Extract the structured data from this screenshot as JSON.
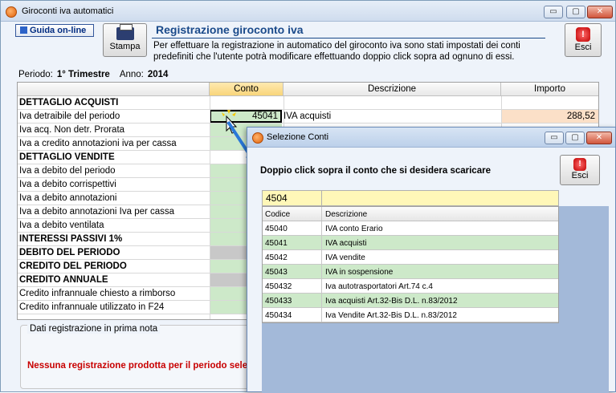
{
  "main_window": {
    "title": "Giroconti iva automatici",
    "controls": {
      "minimize": "▭",
      "maximize": "▢",
      "close": "✕"
    }
  },
  "toolbar": {
    "guida_label": "Guida on-line",
    "stampa_label": "Stampa",
    "esci_label": "Esci",
    "esci_icon": "!"
  },
  "header": {
    "title": "Registrazione giroconto iva",
    "description": "Per effettuare la registrazione in automatico del giroconto iva sono stati impostati dei conti predefiniti che l'utente potrà modificare effettuando doppio click sopra ad ognuno di essi."
  },
  "period": {
    "periodo_label": "Periodo:",
    "periodo_value": "1° Trimestre",
    "anno_label": "Anno:",
    "anno_value": "2014"
  },
  "grid": {
    "columns": {
      "conto": "Conto",
      "descrizione": "Descrizione",
      "importo": "Importo"
    },
    "rows": [
      {
        "label": "DETTAGLIO ACQUISTI",
        "bold": true,
        "conto_style": "none"
      },
      {
        "label": "Iva detraibile del periodo",
        "conto": "45041",
        "descrizione": "IVA acquisti",
        "importo": "288,52",
        "conto_style": "selected"
      },
      {
        "label": "Iva acq. Non detr. Prorata",
        "conto_style": "green"
      },
      {
        "label": "Iva a credito annotazioni iva per cassa",
        "conto_style": "green"
      },
      {
        "label": "DETTAGLIO VENDITE",
        "bold": true,
        "conto_style": "none"
      },
      {
        "label": "Iva a debito del periodo",
        "conto_style": "green"
      },
      {
        "label": "Iva a debito corrispettivi",
        "conto_style": "green"
      },
      {
        "label": "Iva a debito annotazioni",
        "conto_style": "green"
      },
      {
        "label": "Iva a debito annotazioni Iva per cassa",
        "conto_style": "green"
      },
      {
        "label": "Iva a debito ventilata",
        "conto_style": "green"
      },
      {
        "label": "INTERESSI PASSIVI 1%",
        "bold": true,
        "conto_style": "green"
      },
      {
        "label": "DEBITO DEL PERIODO",
        "bold": true,
        "conto_style": "gray"
      },
      {
        "label": "CREDITO DEL PERIODO",
        "bold": true,
        "conto_style": "green"
      },
      {
        "label": "CREDITO ANNUALE",
        "bold": true,
        "conto_style": "gray"
      },
      {
        "label": "Credito infrannuale chiesto a rimborso",
        "conto_style": "green"
      },
      {
        "label": "Credito infrannuale utilizzato in F24",
        "conto_style": "green"
      }
    ]
  },
  "dati_registrazione": {
    "title": "Dati registrazione in prima nota",
    "message": "Nessuna registrazione prodotta per il periodo sele"
  },
  "dialog": {
    "title": "Selezione Conti",
    "instruction": "Doppio click sopra il conto che si desidera scaricare",
    "esci_label": "Esci",
    "search_value": "4504",
    "columns": {
      "codice": "Codice",
      "descrizione": "Descrizione"
    },
    "rows": [
      {
        "codice": "45040",
        "descrizione": "IVA conto Erario"
      },
      {
        "codice": "45041",
        "descrizione": "IVA acquisti"
      },
      {
        "codice": "45042",
        "descrizione": "IVA vendite"
      },
      {
        "codice": "45043",
        "descrizione": "IVA in sospensione"
      },
      {
        "codice": "450432",
        "descrizione": "Iva autotrasportatori Art.74 c.4"
      },
      {
        "codice": "450433",
        "descrizione": "Iva acquisti Art.32-Bis D.L. n.83/2012"
      },
      {
        "codice": "450434",
        "descrizione": "Iva Vendite Art.32-Bis D.L. n.83/2012"
      }
    ]
  },
  "colors": {
    "accent_title": "#1a4a8a",
    "green_cell": "#cde9c9",
    "error_text": "#c80000",
    "search_bg": "#fff7b8"
  }
}
